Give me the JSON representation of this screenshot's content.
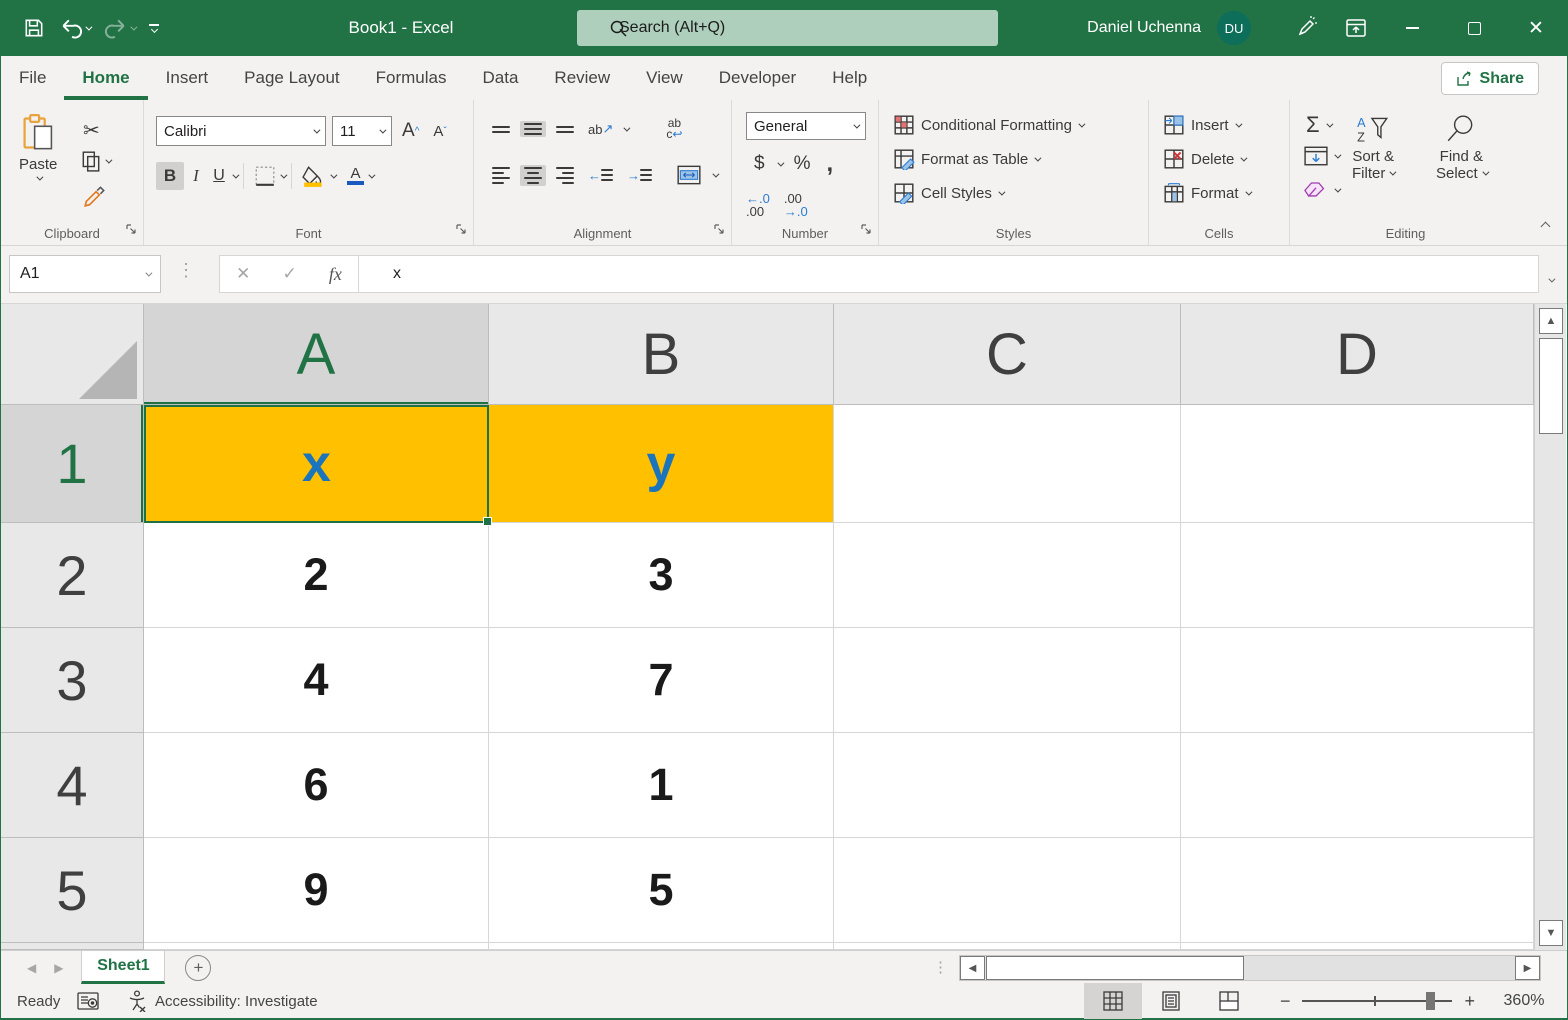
{
  "titlebar": {
    "title": "Book1  -  Excel",
    "search_text": "Search (Alt+Q)",
    "user_name": "Daniel Uchenna",
    "user_initials": "DU"
  },
  "menu": {
    "tabs": [
      "File",
      "Home",
      "Insert",
      "Page Layout",
      "Formulas",
      "Data",
      "Review",
      "View",
      "Developer",
      "Help"
    ],
    "share_label": "Share"
  },
  "ribbon": {
    "clipboard": {
      "label": "Clipboard",
      "paste": "Paste"
    },
    "font": {
      "label": "Font",
      "font_name": "Calibri",
      "font_size": "11",
      "bold": "B",
      "italic": "I",
      "underline": "U",
      "grow": "A",
      "shrink": "A"
    },
    "alignment": {
      "label": "Alignment",
      "wrap_ab": "ab",
      "wrap_c": "c",
      "orient_ab": "ab"
    },
    "number": {
      "label": "Number",
      "format": "General",
      "currency": "$",
      "percent": "%",
      "comma": ",",
      "inc_top": "←.0",
      "inc_bot": ".00",
      "dec_top": ".00",
      "dec_bot": "→.0"
    },
    "styles": {
      "label": "Styles",
      "conditional": "Conditional Formatting",
      "format_table": "Format as Table",
      "cell_styles": "Cell Styles"
    },
    "cells": {
      "label": "Cells",
      "insert": "Insert",
      "delete": "Delete",
      "format": "Format"
    },
    "editing": {
      "label": "Editing",
      "autosum": "Σ",
      "sort1": "Sort &",
      "sort2": "Filter",
      "find1": "Find &",
      "find2": "Select"
    }
  },
  "formula_bar": {
    "name_box": "A1",
    "cancel": "✕",
    "enter": "✓",
    "fx": "fx",
    "content": "x"
  },
  "grid": {
    "col_headers": [
      "A",
      "B",
      "C",
      "D"
    ],
    "row_headers": [
      "1",
      "2",
      "3",
      "4",
      "5"
    ],
    "rows": [
      [
        "x",
        "y",
        "",
        ""
      ],
      [
        "2",
        "3",
        "",
        ""
      ],
      [
        "4",
        "7",
        "",
        ""
      ],
      [
        "6",
        "1",
        "",
        ""
      ],
      [
        "9",
        "5",
        "",
        ""
      ]
    ],
    "highlight_color": "#FFC000",
    "header_text_color": "#1B75BC",
    "selection_color": "#1E7145"
  },
  "sheet_bar": {
    "active_tab": "Sheet1"
  },
  "status_bar": {
    "mode": "Ready",
    "accessibility": "Accessibility: Investigate",
    "zoom_out": "−",
    "zoom_in": "+",
    "zoom_level": "360%"
  }
}
